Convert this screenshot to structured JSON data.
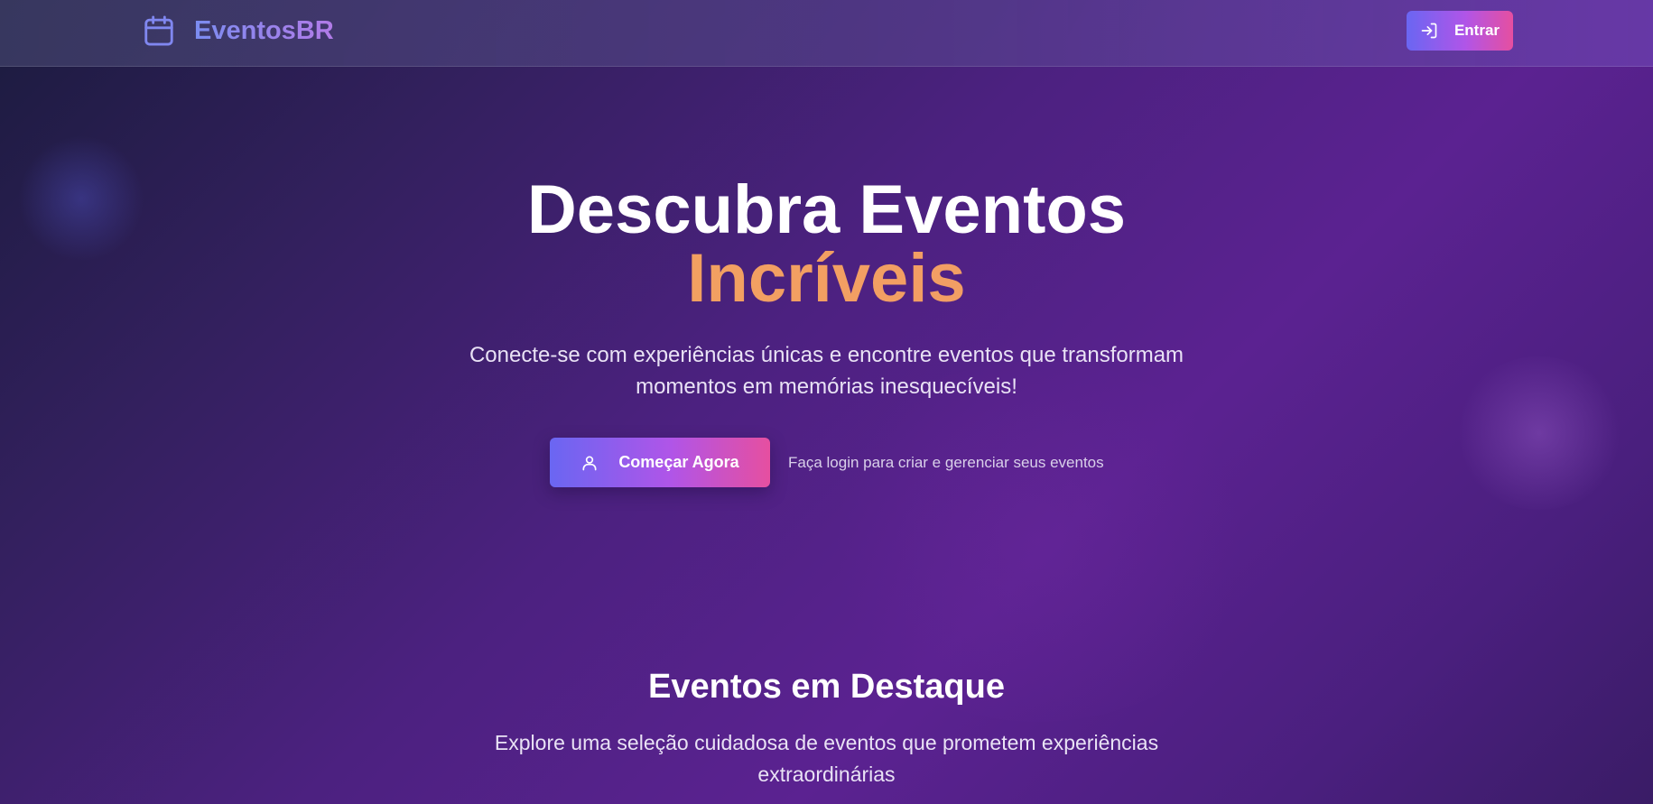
{
  "header": {
    "brand_name": "EventosBR",
    "brand_icon": "calendar-icon",
    "login_label": "Entrar",
    "login_icon": "log-in-icon"
  },
  "hero": {
    "title_line1": "Descubra Eventos",
    "title_line2": "Incríveis",
    "subtitle_line1": "Conecte-se com experiências únicas e encontre eventos que transformam",
    "subtitle_line2": "momentos em memórias inesquecíveis!",
    "cta_label": "Começar Agora",
    "cta_icon": "user-icon",
    "cta_hint": "Faça login para criar e gerenciar seus eventos"
  },
  "featured": {
    "title": "Eventos em Destaque",
    "subtitle_line1": "Explore uma seleção cuidadosa de eventos que prometem experiências",
    "subtitle_line2": "extraordinárias"
  },
  "colors": {
    "accent_gradient_start": "#6a66f2",
    "accent_gradient_end": "#e64fa0",
    "highlight_orange": "#f2a060",
    "brand_text": "#8f86ee"
  }
}
